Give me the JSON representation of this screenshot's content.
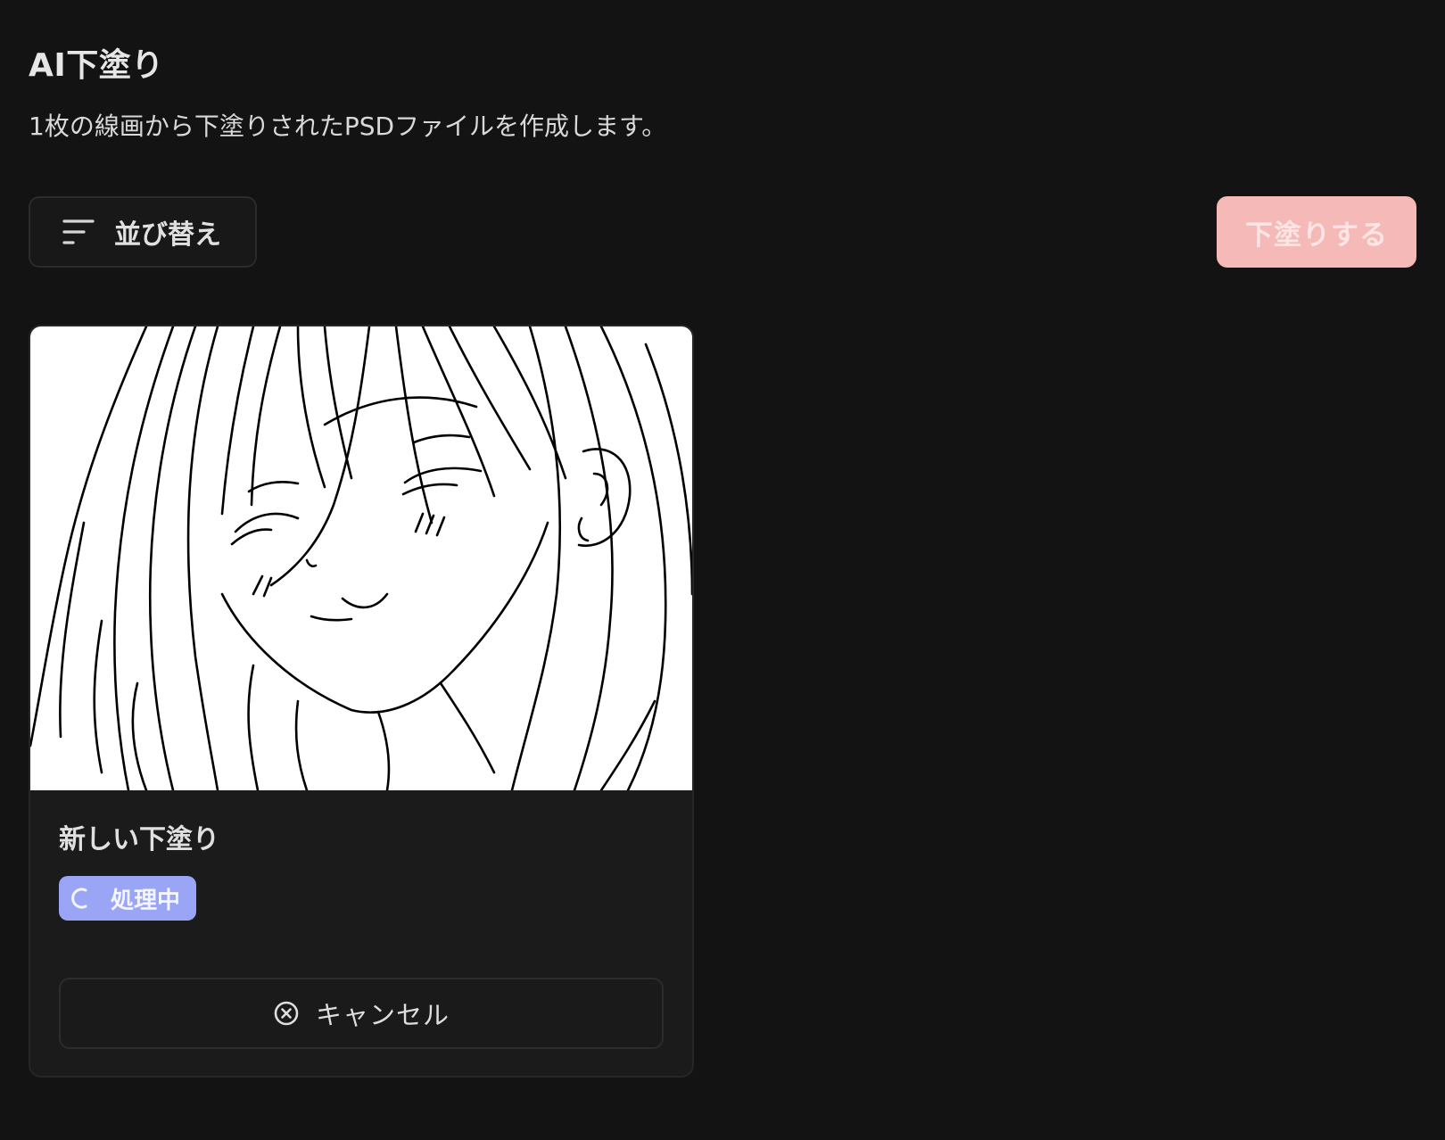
{
  "header": {
    "title": "AI下塗り",
    "subtitle": "1枚の線画から下塗りされたPSDファイルを作成します。"
  },
  "toolbar": {
    "sort_label": "並び替え",
    "sort_icon": "sort-lines-icon",
    "primary_label": "下塗りする"
  },
  "cards": [
    {
      "title": "新しい下塗り",
      "thumbnail": "line-art-anime-girl",
      "status": {
        "label": "処理中",
        "icon": "spinner-icon",
        "color": "#9aa6f5"
      },
      "cancel_label": "キャンセル",
      "cancel_icon": "circle-x-icon"
    }
  ],
  "colors": {
    "background": "#131313",
    "primary": "#f5b9b7",
    "status_processing": "#9aa6f5"
  }
}
